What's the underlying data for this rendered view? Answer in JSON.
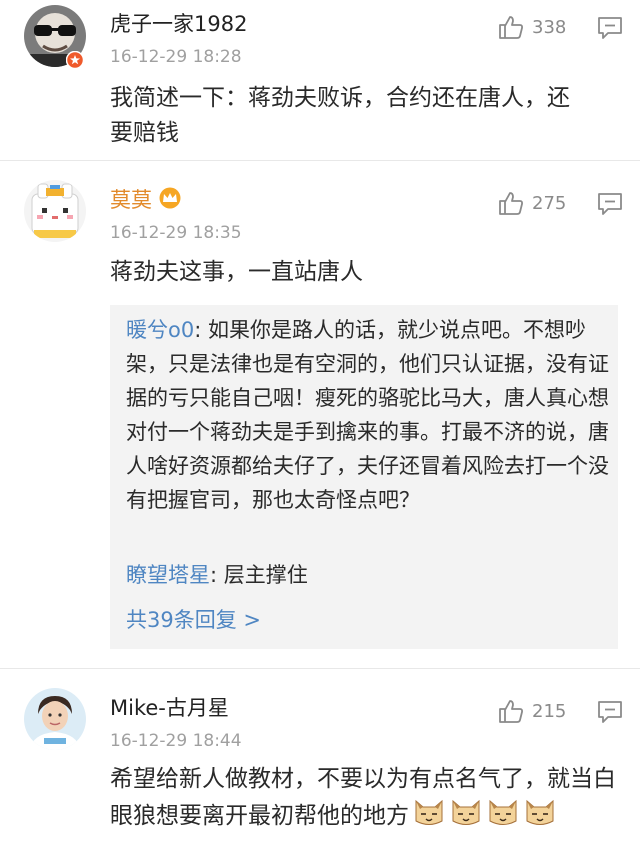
{
  "comments": [
    {
      "username": "虎子一家1982",
      "timestamp": "16-12-29 18:28",
      "likes": "338",
      "text": "我简述一下：蒋劲夫败诉，合约还在唐人，还要赔钱"
    },
    {
      "username": "莫莫",
      "timestamp": "16-12-29 18:35",
      "likes": "275",
      "text": "蒋劲夫这事，一直站唐人",
      "replies": [
        {
          "name": "暖兮o0",
          "text": ": 如果你是路人的话，就少说点吧。不想吵架，只是法律也是有空洞的，他们只认证据，没有证据的亏只能自己咽！瘦死的骆驼比马大，唐人真心想对付一个蒋劲夫是手到擒来的事。打最不济的说，唐人啥好资源都给夫仔了，夫仔还冒着风险去打一个没有把握官司，那也太奇怪点吧？"
        },
        {
          "name": "瞭望塔星",
          "text": ": 层主撑住"
        }
      ],
      "more_replies": "共39条回复 >"
    },
    {
      "username": "Mike-古月星",
      "timestamp": "16-12-29 18:44",
      "likes": "215",
      "text": "希望给新人做教材，不要以为有点名气了，就当白眼狼想要离开最初帮他的地方"
    }
  ],
  "icons": {
    "like": "thumbs-up-icon",
    "reply": "comment-icon",
    "emoji": "cat-emoji-icon",
    "badge": "crown-badge-icon"
  },
  "colors": {
    "link": "#4f86c2",
    "username_vip": "#e28a2b",
    "meta": "#a0a0a0",
    "reply_bg": "#f3f3f3"
  }
}
